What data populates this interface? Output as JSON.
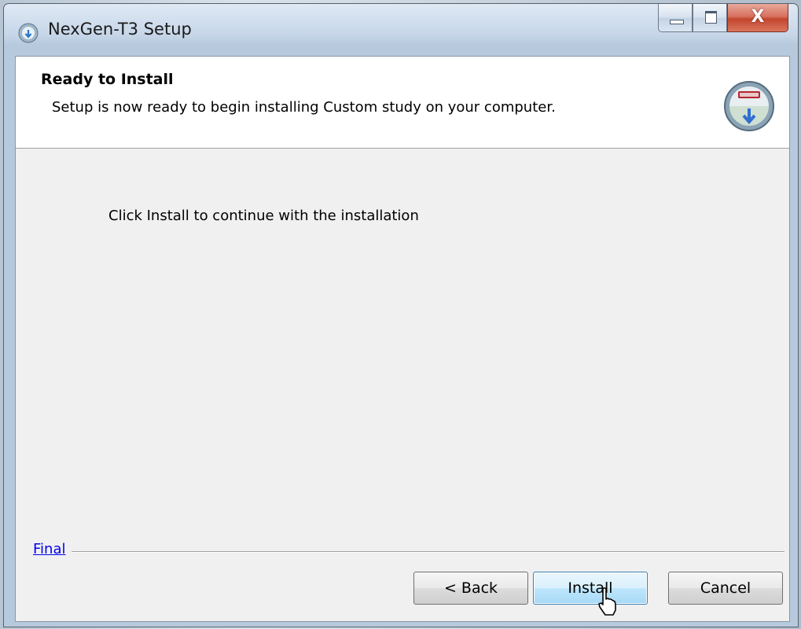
{
  "window": {
    "title": "NexGen-T3 Setup",
    "close_glyph": "X"
  },
  "header": {
    "title": "Ready to Install",
    "subtitle": "Setup is now ready to begin installing Custom study on your computer."
  },
  "main": {
    "instruction": "Click Install to continue with the installation"
  },
  "footer": {
    "link_label": "Final",
    "back_label": "< Back",
    "install_label": "Install",
    "cancel_label": "Cancel"
  },
  "icons": {
    "app": "installer-globe-icon",
    "header": "installer-disc-icon",
    "cursor": "mouse-pointer-icon"
  },
  "colors": {
    "link": "#0000ee",
    "close_button": "#c4452e",
    "focused_button_border": "#3c7fb1"
  }
}
